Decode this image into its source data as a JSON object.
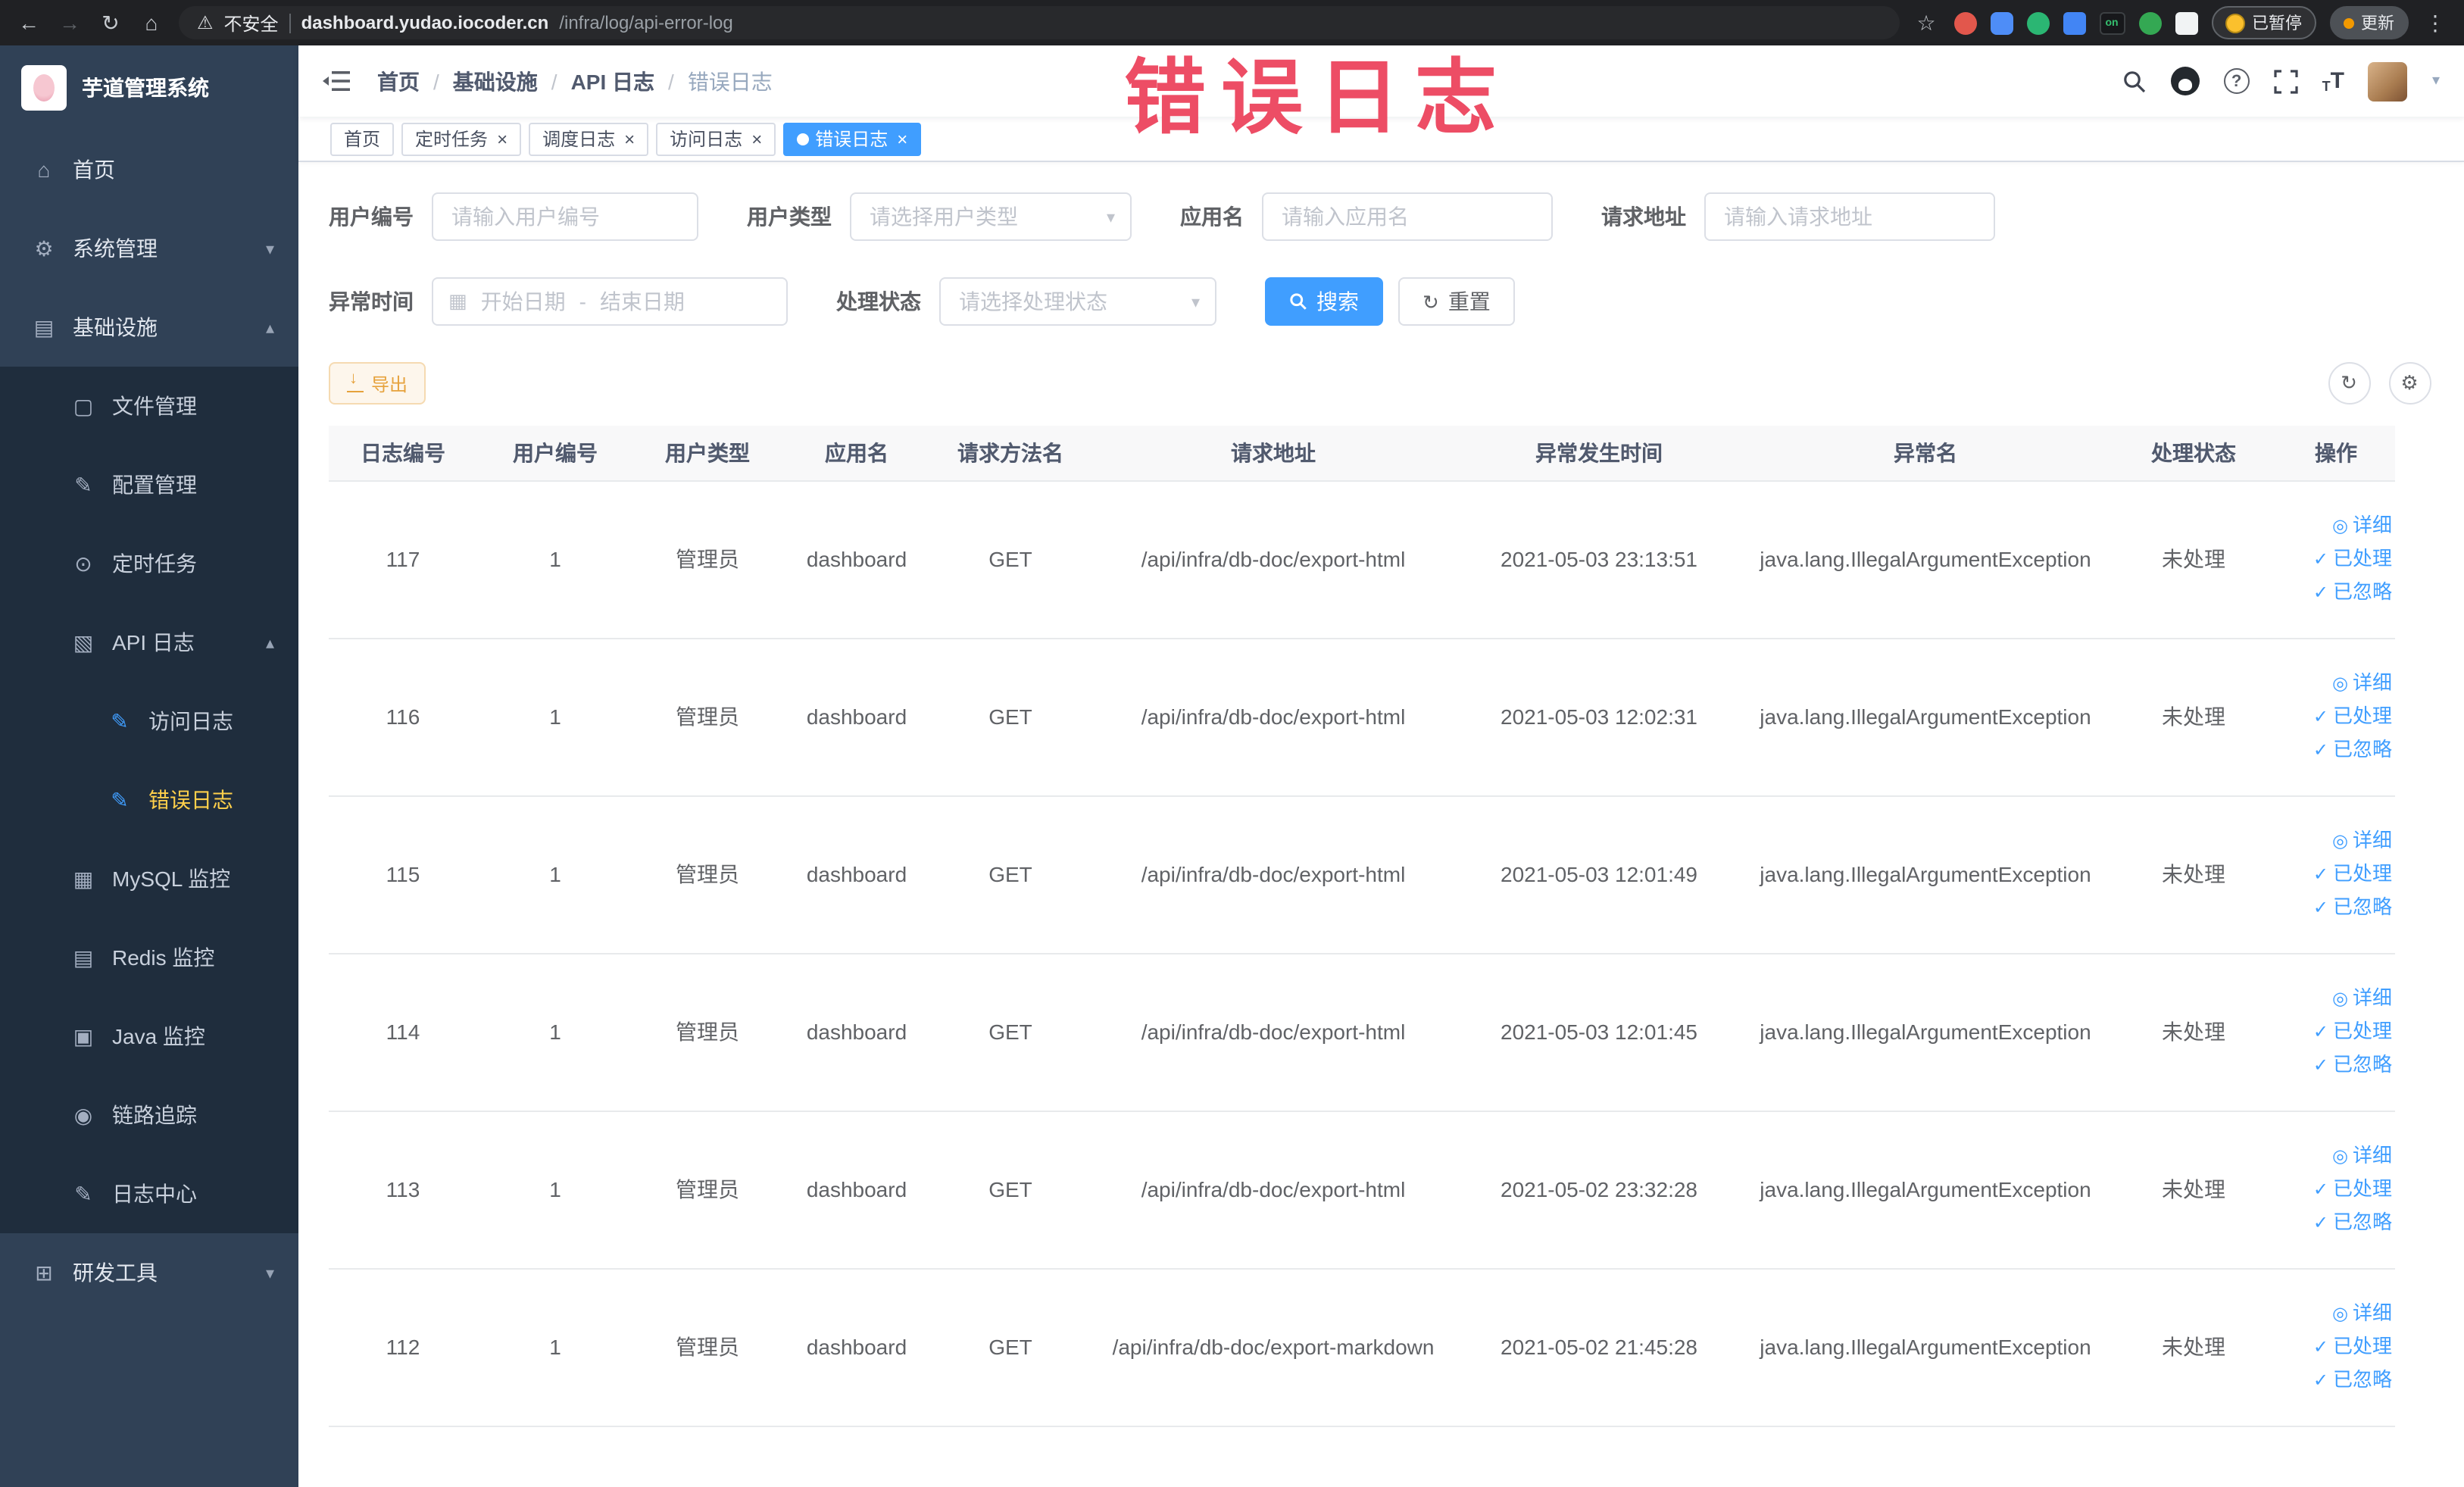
{
  "browser": {
    "security_label": "不安全",
    "url_host": "dashboard.yudao.iocoder.cn",
    "url_path": "/infra/log/api-error-log",
    "extension_badge": "on",
    "paused_label": "已暂停",
    "update_label": "更新"
  },
  "sidebar": {
    "logo_title": "芋道管理系统",
    "items": [
      {
        "name": "sidebar-item-home",
        "label": "首页",
        "level": 1,
        "icon": "home-icon",
        "glyph": "⌂",
        "arrow": ""
      },
      {
        "name": "sidebar-item-system",
        "label": "系统管理",
        "level": 1,
        "icon": "gear-icon",
        "glyph": "⚙",
        "arrow": "down"
      },
      {
        "name": "sidebar-item-infra",
        "label": "基础设施",
        "level": 1,
        "icon": "infrastructure-icon",
        "glyph": "▤",
        "arrow": "up"
      },
      {
        "name": "sidebar-item-files",
        "label": "文件管理",
        "level": 2,
        "icon": "file-manage-icon",
        "glyph": "▢",
        "arrow": ""
      },
      {
        "name": "sidebar-item-config",
        "label": "配置管理",
        "level": 2,
        "icon": "config-manage-icon",
        "glyph": "✎",
        "arrow": ""
      },
      {
        "name": "sidebar-item-scheduler",
        "label": "定时任务",
        "level": 2,
        "icon": "timer-icon",
        "glyph": "⊙",
        "arrow": ""
      },
      {
        "name": "sidebar-item-api-log",
        "label": "API 日志",
        "level": 2,
        "icon": "api-log-icon",
        "glyph": "▧",
        "arrow": "up"
      },
      {
        "name": "sidebar-item-access-log",
        "label": "访问日志",
        "level": 3,
        "icon": "access-log-icon",
        "glyph": "✎",
        "icon_color": "blue",
        "arrow": ""
      },
      {
        "name": "sidebar-item-error-log",
        "label": "错误日志",
        "level": 3,
        "icon": "error-log-icon",
        "glyph": "✎",
        "icon_color": "blue",
        "active": true,
        "arrow": ""
      },
      {
        "name": "sidebar-item-mysql",
        "label": "MySQL 监控",
        "level": 2,
        "icon": "mysql-monitor-icon",
        "glyph": "▦",
        "arrow": ""
      },
      {
        "name": "sidebar-item-redis",
        "label": "Redis 监控",
        "level": 2,
        "icon": "redis-monitor-icon",
        "glyph": "▤",
        "arrow": ""
      },
      {
        "name": "sidebar-item-java",
        "label": "Java 监控",
        "level": 2,
        "icon": "java-monitor-icon",
        "glyph": "▣",
        "arrow": ""
      },
      {
        "name": "sidebar-item-trace",
        "label": "链路追踪",
        "level": 2,
        "icon": "trace-icon",
        "glyph": "◉",
        "arrow": ""
      },
      {
        "name": "sidebar-item-log-center",
        "label": "日志中心",
        "level": 2,
        "icon": "log-center-icon",
        "glyph": "✎",
        "arrow": ""
      },
      {
        "name": "sidebar-item-dev-tools",
        "label": "研发工具",
        "level": 1,
        "icon": "dev-tools-icon",
        "glyph": "⊞",
        "arrow": "down"
      }
    ]
  },
  "header": {
    "breadcrumb": [
      "首页",
      "基础设施",
      "API 日志",
      "错误日志"
    ],
    "separator": "/"
  },
  "tabs": [
    {
      "label": "首页",
      "active": false,
      "closable": false
    },
    {
      "label": "定时任务",
      "active": false,
      "closable": true
    },
    {
      "label": "调度日志",
      "active": false,
      "closable": true
    },
    {
      "label": "访问日志",
      "active": false,
      "closable": true
    },
    {
      "label": "错误日志",
      "active": true,
      "closable": true
    }
  ],
  "watermark": "错误日志",
  "filters": {
    "user_id_label": "用户编号",
    "user_id_placeholder": "请输入用户编号",
    "user_type_label": "用户类型",
    "user_type_placeholder": "请选择用户类型",
    "app_name_label": "应用名",
    "app_name_placeholder": "请输入应用名",
    "request_url_label": "请求地址",
    "request_url_placeholder": "请输入请求地址",
    "exception_time_label": "异常时间",
    "date_start_placeholder": "开始日期",
    "date_separator": "-",
    "date_end_placeholder": "结束日期",
    "process_status_label": "处理状态",
    "process_status_placeholder": "请选择处理状态",
    "search_label": "搜索",
    "reset_label": "重置"
  },
  "toolbar": {
    "export_label": "导出"
  },
  "table": {
    "columns": [
      "日志编号",
      "用户编号",
      "用户类型",
      "应用名",
      "请求方法名",
      "请求地址",
      "异常发生时间",
      "异常名",
      "处理状态",
      "操作"
    ],
    "action_detail": "详细",
    "action_processed": "已处理",
    "action_ignored": "已忽略",
    "rows": [
      {
        "id": "117",
        "user_id": "1",
        "user_type": "管理员",
        "app": "dashboard",
        "method": "GET",
        "url": "/api/infra/db-doc/export-html",
        "time": "2021-05-03 23:13:51",
        "exception": "java.lang.IllegalArgumentException",
        "status": "未处理"
      },
      {
        "id": "116",
        "user_id": "1",
        "user_type": "管理员",
        "app": "dashboard",
        "method": "GET",
        "url": "/api/infra/db-doc/export-html",
        "time": "2021-05-03 12:02:31",
        "exception": "java.lang.IllegalArgumentException",
        "status": "未处理"
      },
      {
        "id": "115",
        "user_id": "1",
        "user_type": "管理员",
        "app": "dashboard",
        "method": "GET",
        "url": "/api/infra/db-doc/export-html",
        "time": "2021-05-03 12:01:49",
        "exception": "java.lang.IllegalArgumentException",
        "status": "未处理"
      },
      {
        "id": "114",
        "user_id": "1",
        "user_type": "管理员",
        "app": "dashboard",
        "method": "GET",
        "url": "/api/infra/db-doc/export-html",
        "time": "2021-05-03 12:01:45",
        "exception": "java.lang.IllegalArgumentException",
        "status": "未处理"
      },
      {
        "id": "113",
        "user_id": "1",
        "user_type": "管理员",
        "app": "dashboard",
        "method": "GET",
        "url": "/api/infra/db-doc/export-html",
        "time": "2021-05-02 23:32:28",
        "exception": "java.lang.IllegalArgumentException",
        "status": "未处理"
      },
      {
        "id": "112",
        "user_id": "1",
        "user_type": "管理员",
        "app": "dashboard",
        "method": "GET",
        "url": "/api/infra/db-doc/export-markdown",
        "time": "2021-05-02 21:45:28",
        "exception": "java.lang.IllegalArgumentException",
        "status": "未处理"
      }
    ]
  }
}
